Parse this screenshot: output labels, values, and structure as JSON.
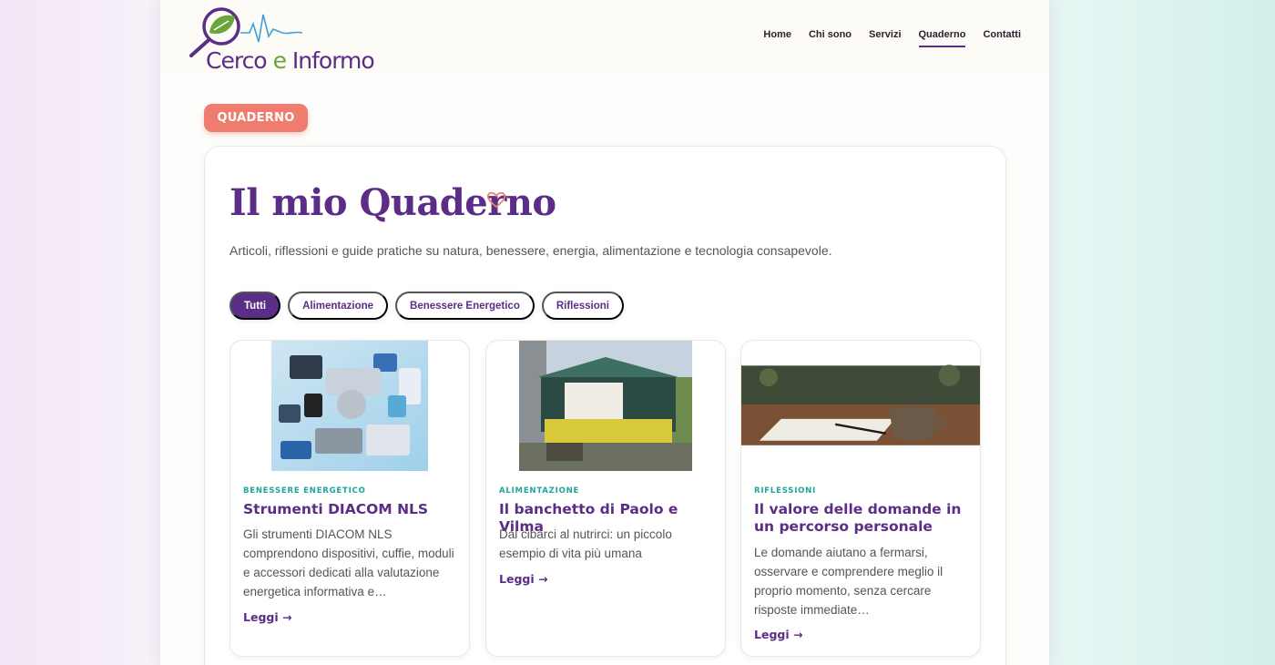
{
  "header": {
    "logo_text_a": "Cerco ",
    "logo_text_e": "e",
    "logo_text_b": " Informo",
    "nav": [
      "Home",
      "Chi sono",
      "Servizi",
      "Quaderno",
      "Contatti"
    ],
    "active_nav": "Quaderno"
  },
  "badge": "QUADERNO",
  "main": {
    "title": "Il mio Quaderno",
    "subtitle": "Articoli, riflessioni e guide pratiche su natura, benessere, energia, alimentazione e tecnologia consapevole.",
    "filters": [
      "Tutti",
      "Alimentazione",
      "Benessere Energetico",
      "Riflessioni"
    ],
    "active_filter": "Tutti"
  },
  "articles": [
    {
      "category": "BENESSERE ENERGETICO",
      "title": "Strumenti DIACOM NLS",
      "excerpt": "Gli strumenti DIACOM NLS comprendono dispositivi, cuffie, moduli e accessori dedicati alla valutazione energetica informativa e…",
      "read": "Leggi →"
    },
    {
      "category": "ALIMENTAZIONE",
      "title": "Il banchetto di Paolo e Vilma",
      "excerpt": "Dal cibarci al nutrirci: un piccolo esempio di vita più umana",
      "read": "Leggi →"
    },
    {
      "category": "RIFLESSIONI",
      "title": "Il valore delle domande in un percorso personale",
      "excerpt": "Le domande aiutano a fermarsi, osservare e comprendere meglio il proprio momento, senza cercare risposte immediate…",
      "read": "Leggi →"
    }
  ],
  "colors": {
    "brand_purple": "#5b2d86",
    "accent_coral": "#ee7d6f",
    "category_teal": "#1aa79a",
    "logo_green": "#6aa43a"
  }
}
